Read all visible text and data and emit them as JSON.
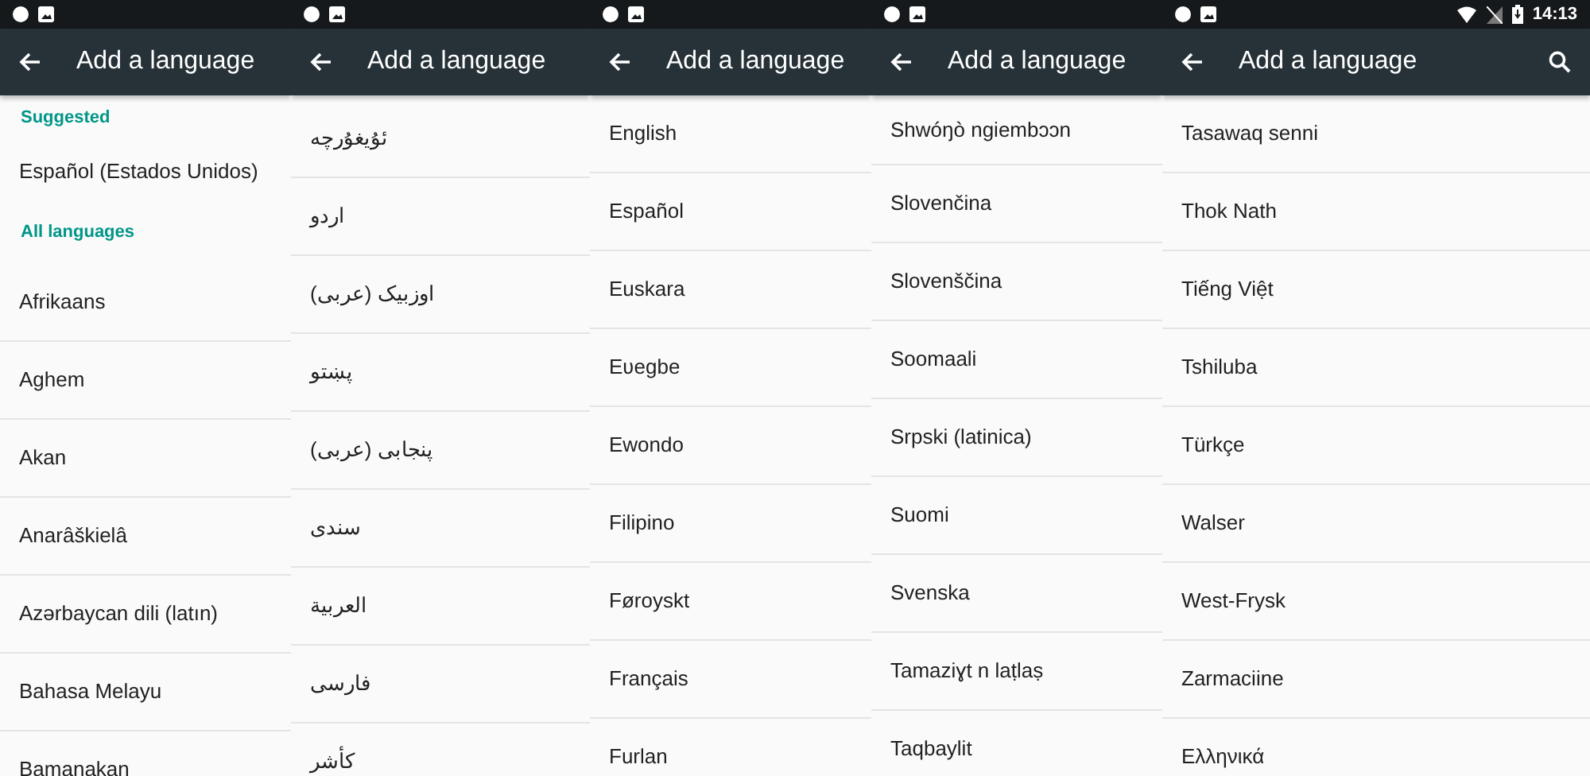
{
  "screens": [
    {
      "app_bar": {
        "title": "Add a language",
        "search_button": false
      },
      "list": [
        {
          "kind": "header",
          "label": "Suggested"
        },
        {
          "kind": "item",
          "label": "Español (Estados Unidos)"
        },
        {
          "kind": "header",
          "label": "All languages"
        },
        {
          "kind": "item",
          "label": "Afrikaans"
        },
        {
          "kind": "item",
          "label": "Aghem"
        },
        {
          "kind": "item",
          "label": "Akan"
        },
        {
          "kind": "item",
          "label": "Anarâškielâ"
        },
        {
          "kind": "item",
          "label": "Azərbaycan dili (latın)"
        },
        {
          "kind": "item",
          "label": "Bahasa Melayu"
        },
        {
          "kind": "item",
          "label": "Bamanakan"
        }
      ]
    },
    {
      "app_bar": {
        "title": "Add a language",
        "search_button": false
      },
      "list": [
        {
          "kind": "item",
          "label": "ئۇيغۇرچە"
        },
        {
          "kind": "item",
          "label": "اردو"
        },
        {
          "kind": "item",
          "label": "اوزبیک (عربی)"
        },
        {
          "kind": "item",
          "label": "پښتو"
        },
        {
          "kind": "item",
          "label": "پنجابی (عربی)"
        },
        {
          "kind": "item",
          "label": "سندی"
        },
        {
          "kind": "item",
          "label": "العربية"
        },
        {
          "kind": "item",
          "label": "فارسی"
        },
        {
          "kind": "item",
          "label": "کأشر"
        }
      ]
    },
    {
      "app_bar": {
        "title": "Add a language",
        "search_button": false
      },
      "list": [
        {
          "kind": "item",
          "label": "English"
        },
        {
          "kind": "item",
          "label": "Español"
        },
        {
          "kind": "item",
          "label": "Euskara"
        },
        {
          "kind": "item",
          "label": "Eʋegbe"
        },
        {
          "kind": "item",
          "label": "Ewondo"
        },
        {
          "kind": "item",
          "label": "Filipino"
        },
        {
          "kind": "item",
          "label": "Føroyskt"
        },
        {
          "kind": "item",
          "label": "Français"
        },
        {
          "kind": "item",
          "label": "Furlan"
        }
      ]
    },
    {
      "app_bar": {
        "title": "Add a language",
        "search_button": false
      },
      "list": [
        {
          "kind": "item",
          "label": "Shwóŋò ngiembɔɔn"
        },
        {
          "kind": "item",
          "label": "Slovenčina"
        },
        {
          "kind": "item",
          "label": "Slovenščina"
        },
        {
          "kind": "item",
          "label": "Soomaali"
        },
        {
          "kind": "item",
          "label": "Srpski (latinica)"
        },
        {
          "kind": "item",
          "label": "Suomi"
        },
        {
          "kind": "item",
          "label": "Svenska"
        },
        {
          "kind": "item",
          "label": "Tamaziɣt n laṭlaṣ"
        },
        {
          "kind": "item",
          "label": "Taqbaylit"
        }
      ]
    },
    {
      "status_bar": {
        "time": "14:13"
      },
      "app_bar": {
        "title": "Add a language",
        "search_button": true
      },
      "list": [
        {
          "kind": "item",
          "label": "Tasawaq senni"
        },
        {
          "kind": "item",
          "label": "Thok Nath"
        },
        {
          "kind": "item",
          "label": "Tiếng Việt"
        },
        {
          "kind": "item",
          "label": "Tshiluba"
        },
        {
          "kind": "item",
          "label": "Türkçe"
        },
        {
          "kind": "item",
          "label": "Walser"
        },
        {
          "kind": "item",
          "label": "West-Frysk"
        },
        {
          "kind": "item",
          "label": "Zarmaciine"
        },
        {
          "kind": "item",
          "label": "Ελληνικά"
        }
      ]
    }
  ]
}
